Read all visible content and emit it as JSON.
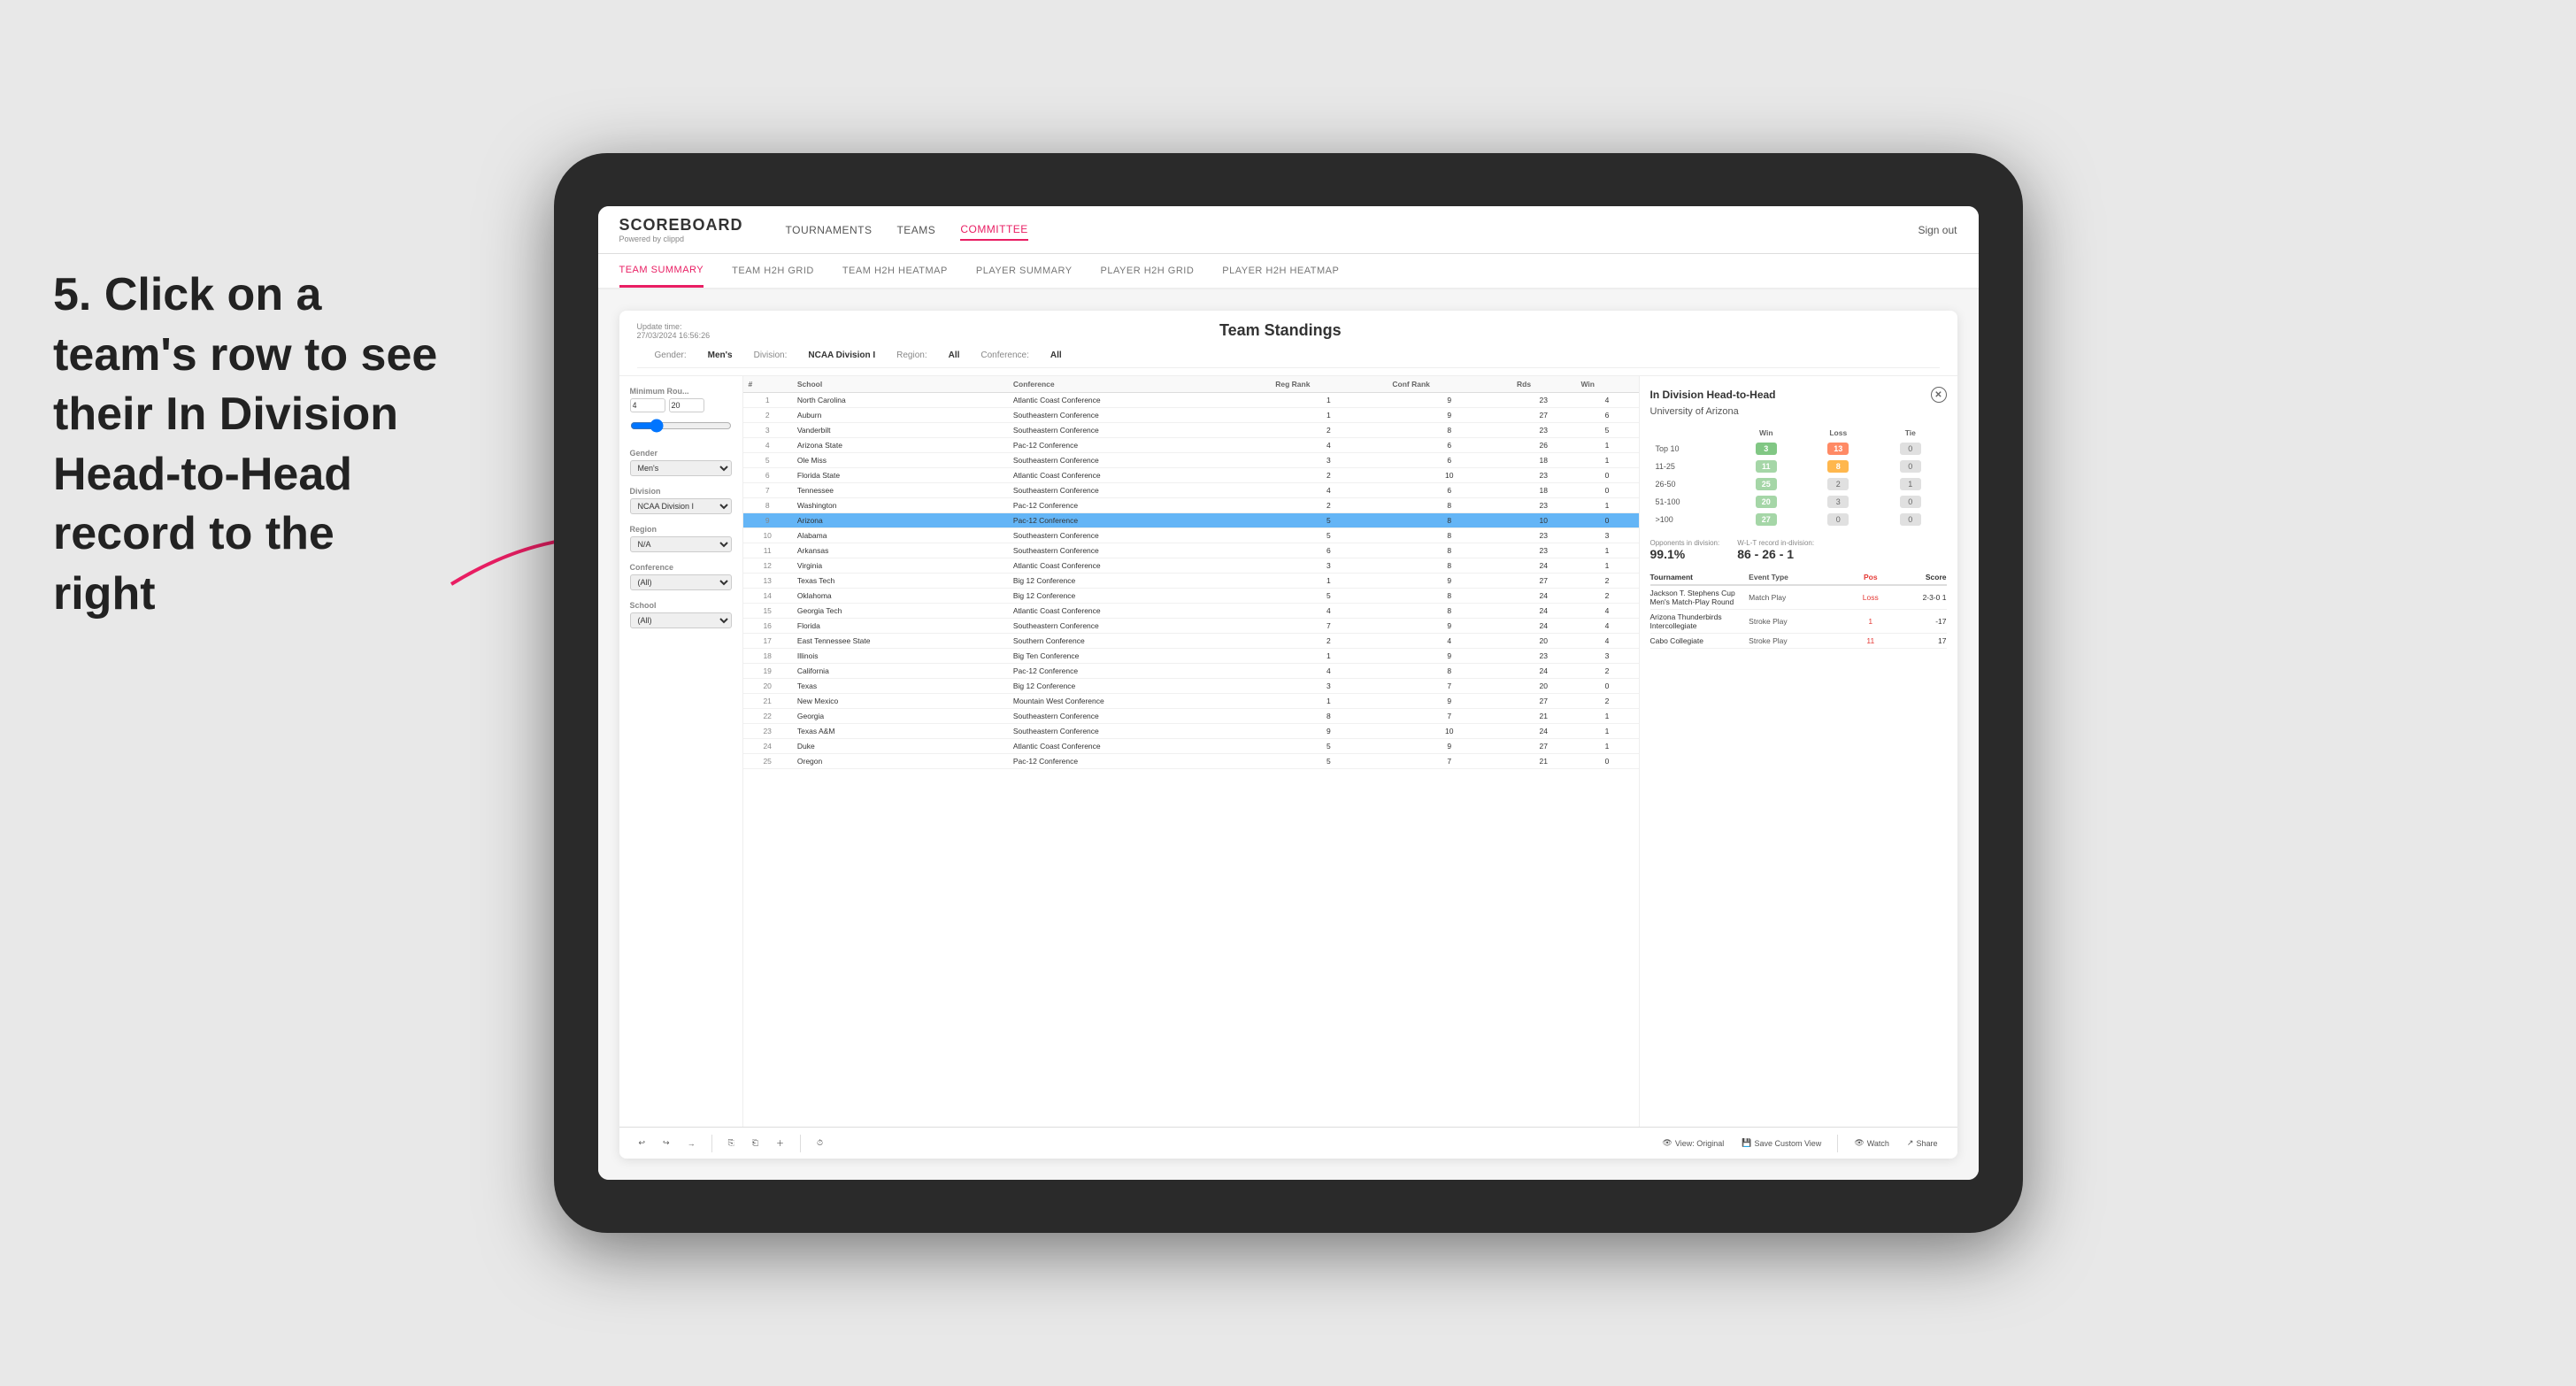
{
  "app": {
    "logo": "SCOREBOARD",
    "logo_sub": "Powered by clippd",
    "sign_out": "Sign out"
  },
  "nav": {
    "items": [
      {
        "label": "TOURNAMENTS",
        "active": false
      },
      {
        "label": "TEAMS",
        "active": false
      },
      {
        "label": "COMMITTEE",
        "active": true
      }
    ]
  },
  "sub_nav": {
    "items": [
      {
        "label": "TEAM SUMMARY",
        "active": true
      },
      {
        "label": "TEAM H2H GRID",
        "active": false
      },
      {
        "label": "TEAM H2H HEATMAP",
        "active": false
      },
      {
        "label": "PLAYER SUMMARY",
        "active": false
      },
      {
        "label": "PLAYER H2H GRID",
        "active": false
      },
      {
        "label": "PLAYER H2H HEATMAP",
        "active": false
      }
    ]
  },
  "dashboard": {
    "title": "Team Standings",
    "update_time_label": "Update time:",
    "update_time": "27/03/2024 16:56:26",
    "filter_gender_label": "Gender:",
    "filter_gender": "Men's",
    "filter_division_label": "Division:",
    "filter_division": "NCAA Division I",
    "filter_region_label": "Region:",
    "filter_region": "All",
    "filter_conference_label": "Conference:",
    "filter_conference": "All"
  },
  "filters": {
    "min_rounds_label": "Minimum Rou...",
    "min_rounds_val": "4",
    "min_rounds_max": "20",
    "gender_label": "Gender",
    "gender_val": "Men's",
    "division_label": "Division",
    "division_val": "NCAA Division I",
    "region_label": "Region",
    "region_val": "N/A",
    "conference_label": "Conference",
    "conference_val": "(All)",
    "school_label": "School",
    "school_val": "(All)"
  },
  "table": {
    "headers": [
      "#",
      "School",
      "Conference",
      "Reg Rank",
      "Conf Rank",
      "Rds",
      "Win"
    ],
    "rows": [
      {
        "rank": 1,
        "school": "North Carolina",
        "conference": "Atlantic Coast Conference",
        "reg_rank": 1,
        "conf_rank": 9,
        "rds": 23,
        "win": 4
      },
      {
        "rank": 2,
        "school": "Auburn",
        "conference": "Southeastern Conference",
        "reg_rank": 1,
        "conf_rank": 9,
        "rds": 27,
        "win": 6
      },
      {
        "rank": 3,
        "school": "Vanderbilt",
        "conference": "Southeastern Conference",
        "reg_rank": 2,
        "conf_rank": 8,
        "rds": 23,
        "win": 5
      },
      {
        "rank": 4,
        "school": "Arizona State",
        "conference": "Pac-12 Conference",
        "reg_rank": 4,
        "conf_rank": 6,
        "rds": 26,
        "win": 1
      },
      {
        "rank": 5,
        "school": "Ole Miss",
        "conference": "Southeastern Conference",
        "reg_rank": 3,
        "conf_rank": 6,
        "rds": 18,
        "win": 1
      },
      {
        "rank": 6,
        "school": "Florida State",
        "conference": "Atlantic Coast Conference",
        "reg_rank": 2,
        "conf_rank": 10,
        "rds": 23,
        "win": 0
      },
      {
        "rank": 7,
        "school": "Tennessee",
        "conference": "Southeastern Conference",
        "reg_rank": 4,
        "conf_rank": 6,
        "rds": 18,
        "win": 0
      },
      {
        "rank": 8,
        "school": "Washington",
        "conference": "Pac-12 Conference",
        "reg_rank": 2,
        "conf_rank": 8,
        "rds": 23,
        "win": 1
      },
      {
        "rank": 9,
        "school": "Arizona",
        "conference": "Pac-12 Conference",
        "reg_rank": 5,
        "conf_rank": 8,
        "rds": 10,
        "win": 0,
        "selected": true
      },
      {
        "rank": 10,
        "school": "Alabama",
        "conference": "Southeastern Conference",
        "reg_rank": 5,
        "conf_rank": 8,
        "rds": 23,
        "win": 3
      },
      {
        "rank": 11,
        "school": "Arkansas",
        "conference": "Southeastern Conference",
        "reg_rank": 6,
        "conf_rank": 8,
        "rds": 23,
        "win": 1
      },
      {
        "rank": 12,
        "school": "Virginia",
        "conference": "Atlantic Coast Conference",
        "reg_rank": 3,
        "conf_rank": 8,
        "rds": 24,
        "win": 1
      },
      {
        "rank": 13,
        "school": "Texas Tech",
        "conference": "Big 12 Conference",
        "reg_rank": 1,
        "conf_rank": 9,
        "rds": 27,
        "win": 2
      },
      {
        "rank": 14,
        "school": "Oklahoma",
        "conference": "Big 12 Conference",
        "reg_rank": 5,
        "conf_rank": 8,
        "rds": 24,
        "win": 2
      },
      {
        "rank": 15,
        "school": "Georgia Tech",
        "conference": "Atlantic Coast Conference",
        "reg_rank": 4,
        "conf_rank": 8,
        "rds": 24,
        "win": 4
      },
      {
        "rank": 16,
        "school": "Florida",
        "conference": "Southeastern Conference",
        "reg_rank": 7,
        "conf_rank": 9,
        "rds": 24,
        "win": 4
      },
      {
        "rank": 17,
        "school": "East Tennessee State",
        "conference": "Southern Conference",
        "reg_rank": 2,
        "conf_rank": 4,
        "rds": 20,
        "win": 4
      },
      {
        "rank": 18,
        "school": "Illinois",
        "conference": "Big Ten Conference",
        "reg_rank": 1,
        "conf_rank": 9,
        "rds": 23,
        "win": 3
      },
      {
        "rank": 19,
        "school": "California",
        "conference": "Pac-12 Conference",
        "reg_rank": 4,
        "conf_rank": 8,
        "rds": 24,
        "win": 2
      },
      {
        "rank": 20,
        "school": "Texas",
        "conference": "Big 12 Conference",
        "reg_rank": 3,
        "conf_rank": 7,
        "rds": 20,
        "win": 0
      },
      {
        "rank": 21,
        "school": "New Mexico",
        "conference": "Mountain West Conference",
        "reg_rank": 1,
        "conf_rank": 9,
        "rds": 27,
        "win": 2
      },
      {
        "rank": 22,
        "school": "Georgia",
        "conference": "Southeastern Conference",
        "reg_rank": 8,
        "conf_rank": 7,
        "rds": 21,
        "win": 1
      },
      {
        "rank": 23,
        "school": "Texas A&M",
        "conference": "Southeastern Conference",
        "reg_rank": 9,
        "conf_rank": 10,
        "rds": 24,
        "win": 1
      },
      {
        "rank": 24,
        "school": "Duke",
        "conference": "Atlantic Coast Conference",
        "reg_rank": 5,
        "conf_rank": 9,
        "rds": 27,
        "win": 1
      },
      {
        "rank": 25,
        "school": "Oregon",
        "conference": "Pac-12 Conference",
        "reg_rank": 5,
        "conf_rank": 7,
        "rds": 21,
        "win": 0
      }
    ]
  },
  "h2h": {
    "title": "In Division Head-to-Head",
    "school": "University of Arizona",
    "col_win": "Win",
    "col_loss": "Loss",
    "col_tie": "Tie",
    "rows": [
      {
        "label": "Top 10",
        "win": 3,
        "loss": 13,
        "tie": 0,
        "win_class": "cell-green",
        "loss_class": "cell-orange"
      },
      {
        "label": "11-25",
        "win": 11,
        "loss": 8,
        "tie": 0,
        "win_class": "cell-lightgreen",
        "loss_class": "cell-lightorange"
      },
      {
        "label": "26-50",
        "win": 25,
        "loss": 2,
        "tie": 1,
        "win_class": "cell-lightgreen",
        "loss_class": "cell-gray"
      },
      {
        "label": "51-100",
        "win": 20,
        "loss": 3,
        "tie": 0,
        "win_class": "cell-lightgreen",
        "loss_class": "cell-gray"
      },
      {
        "label": ">100",
        "win": 27,
        "loss": 0,
        "tie": 0,
        "win_class": "cell-lightgreen",
        "loss_class": "cell-gray"
      }
    ],
    "opponents_label": "Opponents in division:",
    "opponents_pct": "99.1%",
    "wlt_label": "W-L-T record in-division:",
    "wlt_record": "86 - 26 - 1",
    "tournament_col1": "Tournament",
    "tournament_col2": "Event Type",
    "tournament_col3": "Pos",
    "tournament_col4": "Score",
    "tournaments": [
      {
        "name": "Jackson T. Stephens Cup Men's Match-Play Round",
        "event_type": "Match Play",
        "result": "Loss",
        "score": "2-3-0 1"
      },
      {
        "name": "Arizona Thunderbirds Intercollegiate",
        "event_type": "Stroke Play",
        "result": "1",
        "score": "-17"
      },
      {
        "name": "Cabo Collegiate",
        "event_type": "Stroke Play",
        "result": "11",
        "score": "17"
      }
    ]
  },
  "annotation": {
    "text": "5. Click on a team's row to see their In Division Head-to-Head record to the right"
  },
  "toolbar": {
    "undo": "↩",
    "redo": "↪",
    "forward": "→",
    "copy": "⎘",
    "paste": "⎗",
    "clock": "⏱",
    "view_original": "View: Original",
    "save_custom": "Save Custom View",
    "watch": "Watch",
    "share": "Share"
  }
}
